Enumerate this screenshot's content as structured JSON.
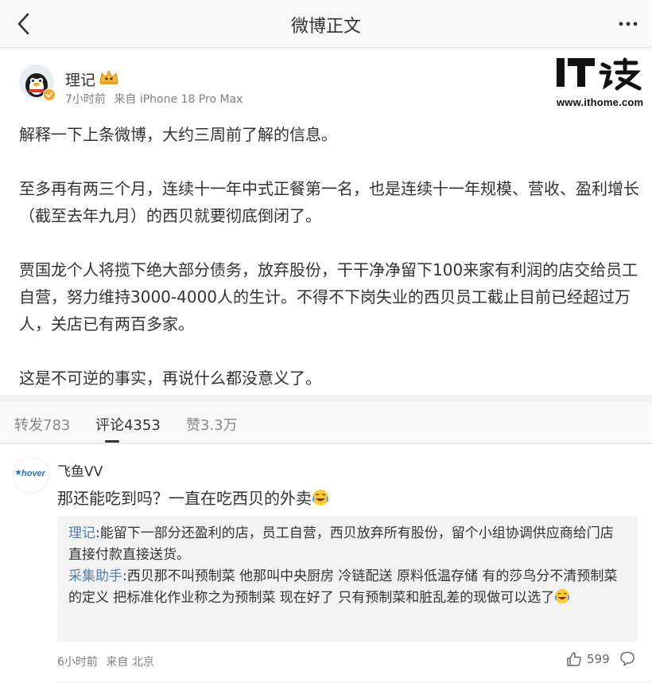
{
  "header": {
    "title": "微博正文",
    "back_icon": "chevron-left-icon",
    "more_icon": "more-dots-icon"
  },
  "post": {
    "author": "理记",
    "time": "7小时前",
    "source": "来自 iPhone 18 Pro Max",
    "paragraphs": [
      "解释一下上条微博，大约三周前了解的信息。",
      "至多再有两三个月，连续十一年中式正餐第一名，也是连续十一年规模、营收、盈利增长（截至去年九月）的西贝就要彻底倒闭了。",
      "贾国龙个人将揽下绝大部分债务，放弃股份，干干净净留下100来家有利润的店交给员工自营，努力维持3000-4000人的生计。不得不下岗失业的西贝员工截止目前已经超过万人，关店已有两百多家。",
      "这是不可逆的事实，再说什么都没意义了。"
    ]
  },
  "watermark": {
    "logo_text": "IT之家",
    "url": "www.ithome.com"
  },
  "tabs": [
    {
      "label": "转发783"
    },
    {
      "label": "评论4353"
    },
    {
      "label": "赞3.3万"
    }
  ],
  "comment": {
    "avatar_text": "hover",
    "name": "飞鱼VV",
    "text": "那还能吃到吗？一直在吃西贝的外卖",
    "replies": [
      {
        "name": "理记",
        "text": ":能留下一部分还盈利的店，员工自营，西贝放弃所有股份，留个小组协调供应商给门店直接付款直接送货。"
      },
      {
        "name": "采集助手",
        "text": ":西贝那不叫预制菜 他那叫中央厨房 冷链配送 原料低温存储 有的莎鸟分不清预制菜的定义 把标准化作业称之为预制菜 现在好了 只有预制菜和脏乱差的现做可以选了"
      }
    ],
    "time": "6小时前",
    "source": "来自 北京",
    "likes": "599"
  },
  "colors": {
    "link_blue": "#4f7db5",
    "text": "#333333",
    "meta_gray": "#808080"
  }
}
